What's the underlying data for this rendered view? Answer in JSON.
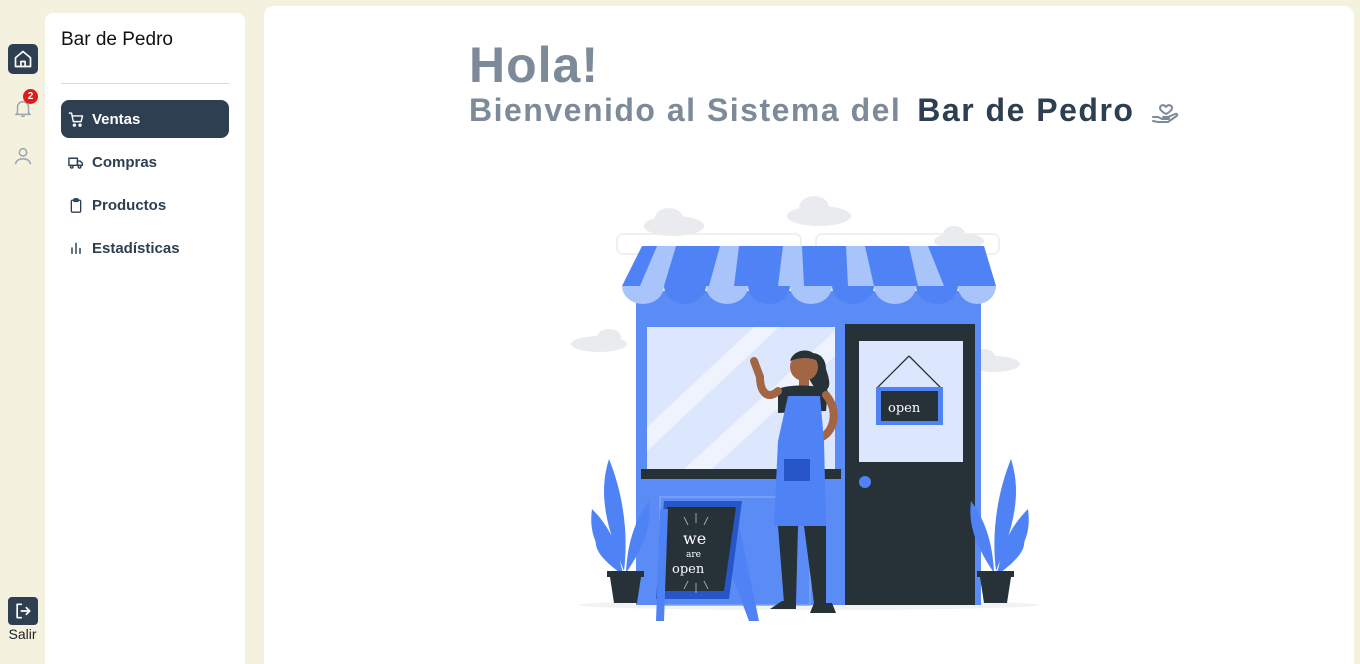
{
  "rail": {
    "notifications_count": "2",
    "logout_label": "Salir",
    "icons": [
      "home-icon",
      "bell-icon",
      "user-icon",
      "logout-icon"
    ]
  },
  "sidebar": {
    "brand": "Bar de Pedro",
    "items": [
      {
        "label": "Ventas",
        "icon": "cart-icon",
        "active": true
      },
      {
        "label": "Compras",
        "icon": "truck-icon",
        "active": false
      },
      {
        "label": "Productos",
        "icon": "clipboard-icon",
        "active": false
      },
      {
        "label": "Estadísticas",
        "icon": "bar-chart-icon",
        "active": false
      }
    ]
  },
  "main": {
    "greeting": "Hola!",
    "welcome_prefix": "Bienvenido al Sistema del",
    "welcome_brand": "Bar de Pedro",
    "illustration": {
      "door_sign": "open",
      "board_line1": "we",
      "board_line2": "are",
      "board_line3": "open"
    }
  },
  "colors": {
    "dark": "#2e3f51",
    "muted": "#7c8a99",
    "background": "#f5f1df",
    "accent_blue": "#4f83f5",
    "badge": "#e01b1b"
  }
}
